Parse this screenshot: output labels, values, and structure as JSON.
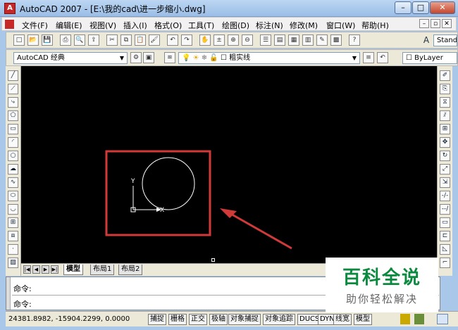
{
  "window": {
    "title": "AutoCAD 2007 - [E:\\我的cad\\进一步缩小.dwg]",
    "icon_letter": "A",
    "controls": {
      "minimize": "–",
      "maximize": "□",
      "close": "✕"
    }
  },
  "menu": {
    "items": [
      "文件(F)",
      "编辑(E)",
      "视图(V)",
      "插入(I)",
      "格式(O)",
      "工具(T)",
      "绘图(D)",
      "标注(N)",
      "修改(M)",
      "窗口(W)",
      "帮助(H)"
    ],
    "doc_controls": {
      "minimize": "–",
      "restore": "▫",
      "close": "✕"
    }
  },
  "toolbar": {
    "text_style": "Stand",
    "icons": [
      "new-icon",
      "open-icon",
      "save-icon",
      "print-icon",
      "preview-icon",
      "publish-icon",
      "cut-icon",
      "copy-icon",
      "paste-icon",
      "matchprop-icon",
      "undo-icon",
      "redo-icon",
      "pan-icon",
      "zoom-realtime-icon",
      "zoom-window-icon",
      "zoom-previous-icon",
      "properties-icon",
      "designcenter-icon",
      "toolpalettes-icon",
      "sheetset-icon",
      "markup-icon",
      "quickcalc-icon",
      "help-icon"
    ]
  },
  "workspace": {
    "name": "AutoCAD 经典",
    "layer": "粗实线",
    "color": "ByLayer"
  },
  "drawing": {
    "annotation_color": "#d23a3a",
    "ucs_y": "Y",
    "ucs_x": "X"
  },
  "layout_tabs": {
    "nav": [
      "|◀",
      "◀",
      "▶",
      "▶|"
    ],
    "tabs": [
      "模型",
      "布局1",
      "布局2"
    ]
  },
  "command": {
    "prompt": "命令:",
    "lines": [
      "命令:",
      "命令:"
    ]
  },
  "status": {
    "coordinates": "24381.8982, -15904.2299, 0.0000",
    "toggles": [
      "捕捉",
      "栅格",
      "正交",
      "极轴",
      "对象捕捉",
      "对象追踪",
      "DUCS",
      "DYN",
      "线宽",
      "模型"
    ]
  },
  "watermark": {
    "title": "百科全说",
    "subtitle": "助你轻松解决"
  },
  "left_tools": [
    "line-icon",
    "xline-icon",
    "polyline-icon",
    "polygon-icon",
    "rectangle-icon",
    "arc-icon",
    "circle-icon",
    "revcloud-icon",
    "spline-icon",
    "ellipse-icon",
    "ellipse-arc-icon",
    "insert-block-icon",
    "make-block-icon",
    "point-icon",
    "hatch-icon"
  ],
  "right_tools": [
    "erase-icon",
    "copy-object-icon",
    "mirror-icon",
    "offset-icon",
    "array-icon",
    "move-icon",
    "rotate-icon",
    "scale-icon",
    "stretch-icon",
    "trim-icon",
    "extend-icon",
    "break-icon",
    "join-icon",
    "chamfer-icon",
    "fillet-icon"
  ]
}
